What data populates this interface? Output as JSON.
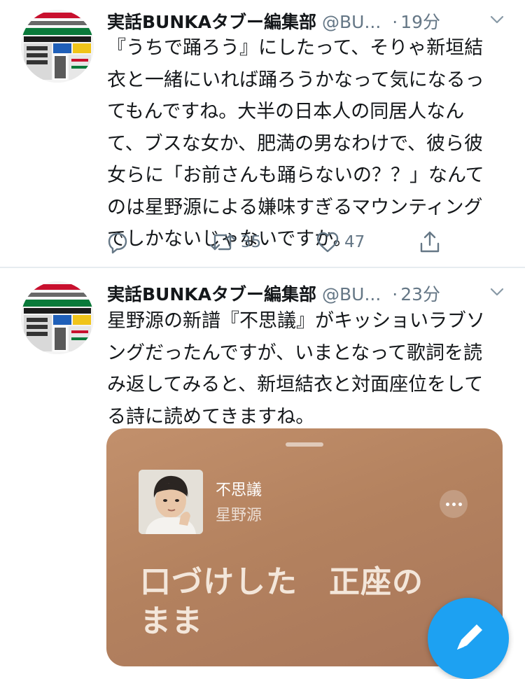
{
  "tweets": [
    {
      "name": "実話BUNKAタブー編集部",
      "handle": "@BU...",
      "separator": "·",
      "time": "19分",
      "text_lines": [
        "『うちで踊ろう』にしたって、そりゃ新垣結",
        "衣と一緒にいれば踊ろうかなって気になるっ",
        "てもんですね。大半の日本人の同居人なん",
        "て、ブスな女か、肥満の男なわけで、彼ら彼",
        "女らに「お前さんも踊らないの？？」なんて",
        "のは星野源による嫌味すぎるマウンティング",
        "でしかないじゃないですか。"
      ],
      "retweets": "35",
      "likes": "47"
    },
    {
      "name": "実話BUNKAタブー編集部",
      "handle": "@BU...",
      "separator": "·",
      "time": "23分",
      "text_lines": [
        "星野源の新譜『不思議』がキッショいラブソ",
        "ングだったんですが、いまとなって歌詞を読",
        "み返してみると、新垣結衣と対面座位をして",
        "る詩に読めてきますね。"
      ],
      "card": {
        "song_title": "不思議",
        "artist": "星野源",
        "lyric_lines": [
          "口づけした　正座の",
          "まま"
        ]
      }
    }
  ],
  "icons": {
    "reply": "reply-icon",
    "retweet": "retweet-icon",
    "like": "heart-icon",
    "share": "share-icon",
    "caret": "chevron-down-icon",
    "compose": "compose-tweet-icon"
  },
  "colors": {
    "accent": "#1da1f2",
    "secondary_text": "#657786",
    "divider": "#e6ecf0",
    "card_background": "#b4825f"
  }
}
